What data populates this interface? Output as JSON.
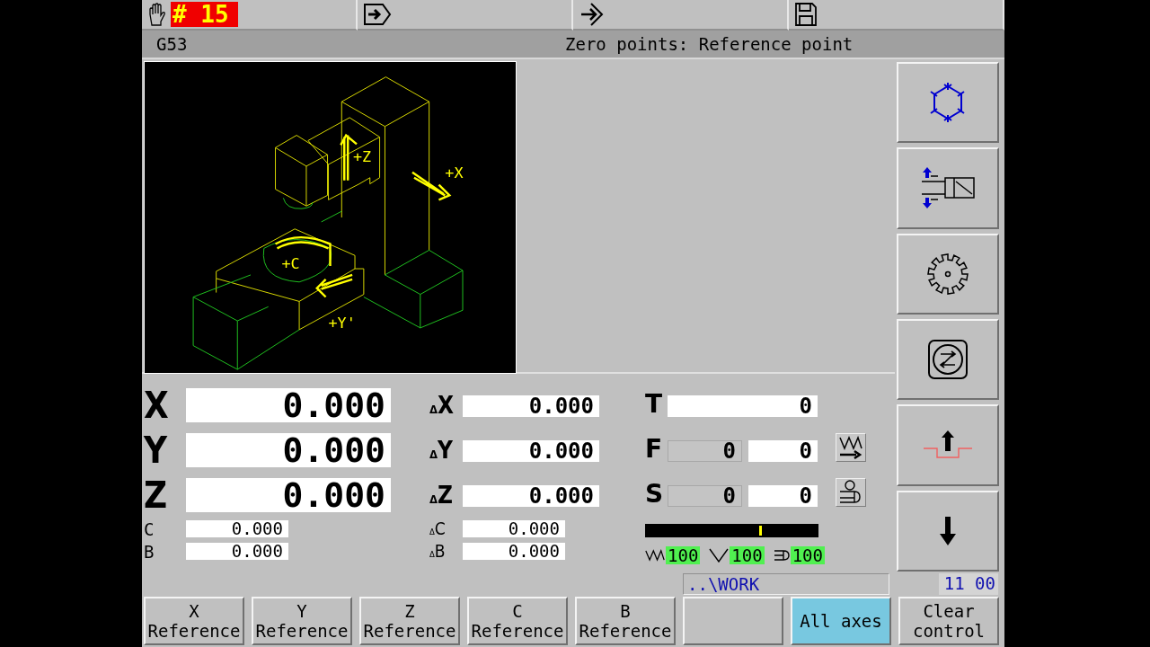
{
  "header": {
    "tabs": [
      {
        "kind": "manual",
        "badge": "# 15"
      },
      {
        "kind": "input"
      },
      {
        "kind": "transfer"
      },
      {
        "kind": "save"
      }
    ]
  },
  "info_bar": {
    "coordinate_system": "G53",
    "title": "Zero points: Reference point"
  },
  "graphic": {
    "axis_labels": [
      "+Z",
      "+X",
      "+C",
      "+Y'"
    ]
  },
  "positions": [
    {
      "axis": "X",
      "value": "0.000",
      "kind": "large"
    },
    {
      "axis": "Y",
      "value": "0.000",
      "kind": "large"
    },
    {
      "axis": "Z",
      "value": "0.000",
      "kind": "large"
    },
    {
      "axis": "C",
      "value": "0.000",
      "kind": "small"
    },
    {
      "axis": "B",
      "value": "0.000",
      "kind": "small"
    }
  ],
  "distances": [
    {
      "prefix": "Δ",
      "axis": "X",
      "value": "0.000",
      "kind": "large"
    },
    {
      "prefix": "Δ",
      "axis": "Y",
      "value": "0.000",
      "kind": "large"
    },
    {
      "prefix": "Δ",
      "axis": "Z",
      "value": "0.000",
      "kind": "large"
    },
    {
      "prefix": "Δ",
      "axis": "C",
      "value": "0.000",
      "kind": "small"
    },
    {
      "prefix": "Δ",
      "axis": "B",
      "value": "0.000",
      "kind": "small"
    }
  ],
  "tool": {
    "label": "T",
    "value": "0"
  },
  "feeds": [
    {
      "kind": "feed",
      "label": "F",
      "actual": "0",
      "programmed": "0"
    },
    {
      "kind": "spindle",
      "label": "S",
      "actual": "0",
      "programmed": "0"
    }
  ],
  "load_meter": {
    "level": 0.66
  },
  "overrides": [
    {
      "kind": "feed",
      "value": "100"
    },
    {
      "kind": "rapid",
      "value": "100"
    },
    {
      "kind": "spindle",
      "value": "100"
    }
  ],
  "softkeys": [
    {
      "kind": "coolant"
    },
    {
      "kind": "clamp"
    },
    {
      "kind": "cutter"
    },
    {
      "kind": "drive"
    },
    {
      "kind": "retract"
    },
    {
      "kind": "lower"
    }
  ],
  "status_bar": {
    "path": "..\\WORK",
    "clock": "11 00"
  },
  "buttons": [
    {
      "lines": [
        "X",
        "Reference"
      ],
      "selected": false
    },
    {
      "lines": [
        "Y",
        "Reference"
      ],
      "selected": false
    },
    {
      "lines": [
        "Z",
        "Reference"
      ],
      "selected": false
    },
    {
      "lines": [
        "C",
        "Reference"
      ],
      "selected": false
    },
    {
      "lines": [
        "B",
        "Reference"
      ],
      "selected": false
    },
    {
      "selected": false
    },
    {
      "lines": [
        "All axes"
      ],
      "selected": true
    },
    {
      "lines": [
        "Clear",
        "control"
      ],
      "selected": false
    }
  ]
}
